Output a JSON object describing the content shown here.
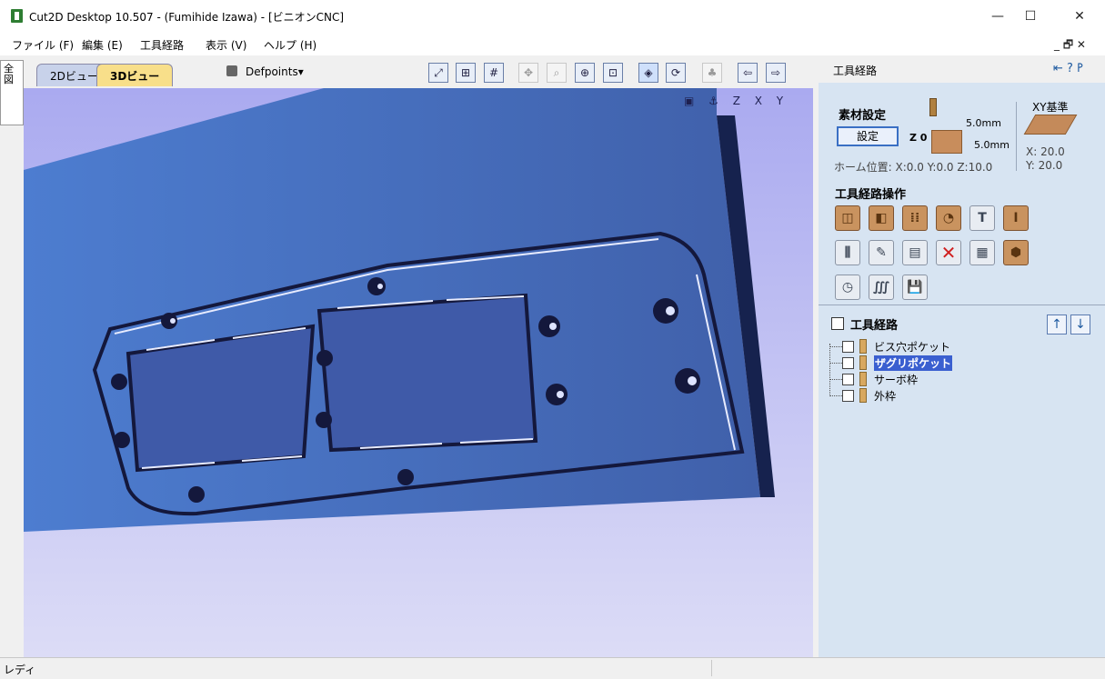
{
  "window": {
    "title": "Cut2D Desktop 10.507 - (Fumihide Izawa) - [ビニオンCNC]",
    "minimize": "—",
    "maximize": "☐",
    "close": "✕"
  },
  "menu": {
    "items": [
      "ファイル (F)",
      "編集 (E)",
      "工具経路",
      "表示 (V)",
      "ヘルプ (H)"
    ],
    "mdi_controls": "_ 🗗 ✕"
  },
  "left_tab": {
    "label": "全図"
  },
  "view_tabs": {
    "tab_2d": "2Dビュー",
    "tab_3d": "3Dビュー"
  },
  "layer": {
    "name": "Defpoints",
    "arrow": "▾"
  },
  "toolbar_icons": [
    "fit-view-icon",
    "grid-snap-icon",
    "grid-icon",
    "pan-icon",
    "zoom-icon",
    "zoom-in-icon",
    "zoom-box-icon",
    "select-icon",
    "transform-icon",
    "render-icon",
    "layer-left-icon",
    "layer-right-icon"
  ],
  "right_panel": {
    "title": "工具経路",
    "pin_controls": "⇤ ? 𐌛",
    "material": {
      "label": "素材設定",
      "setup_button": "設定",
      "z0_label": "Z 0",
      "top_offset": "5.0mm",
      "bottom_offset": "5.0mm",
      "home_position": "ホーム位置: X:0.0 Y:0.0 Z:10.0",
      "xy_title": "XY基準",
      "xy_x": "X: 20.0",
      "xy_y": "Y: 20.0"
    },
    "operations_label": "工具経路操作",
    "operations": [
      {
        "name": "profile-icon",
        "glyph": "◫",
        "style": "brown"
      },
      {
        "name": "pocket-icon",
        "glyph": "◧",
        "style": "brown"
      },
      {
        "name": "drill-icon",
        "glyph": "⁞⁞",
        "style": "brown"
      },
      {
        "name": "inlay-icon",
        "glyph": "◔",
        "style": "brown"
      },
      {
        "name": "text-engrave-icon",
        "glyph": "T",
        "style": "gray"
      },
      {
        "name": "v-carve-icon",
        "glyph": "I",
        "style": "brown"
      },
      {
        "name": "tool-database-icon",
        "glyph": "⫼",
        "style": "gray"
      },
      {
        "name": "edit-toolpath-icon",
        "glyph": "✎",
        "style": "gray"
      },
      {
        "name": "toolpath-summary-icon",
        "glyph": "▤",
        "style": "gray"
      },
      {
        "name": "delete-toolpath-icon",
        "glyph": "✕",
        "style": "red"
      },
      {
        "name": "calculator-icon",
        "glyph": "▦",
        "style": "gray"
      },
      {
        "name": "preview-icon",
        "glyph": "⬢",
        "style": "brown"
      },
      {
        "name": "time-estimate-icon",
        "glyph": "◷",
        "style": "gray"
      },
      {
        "name": "toolpath-template-icon",
        "glyph": "∭",
        "style": "gray"
      },
      {
        "name": "save-toolpath-icon",
        "glyph": "💾",
        "style": "gray"
      }
    ],
    "toolpath_list": {
      "title": "工具経路",
      "items": [
        {
          "label": "ビス穴ポケット",
          "selected": false
        },
        {
          "label": "ザグリポケット",
          "selected": true
        },
        {
          "label": "サーボ枠",
          "selected": false
        },
        {
          "label": "外枠",
          "selected": false
        }
      ],
      "up": "↑",
      "down": "↓"
    }
  },
  "view3d": {
    "nav_icons": "▣ ⚓ Z X Y"
  },
  "status": {
    "text": "レディ"
  },
  "colors": {
    "background_top": "#4b73c4",
    "panel_bg": "#d7e4f2",
    "material": "#c88d5c"
  }
}
